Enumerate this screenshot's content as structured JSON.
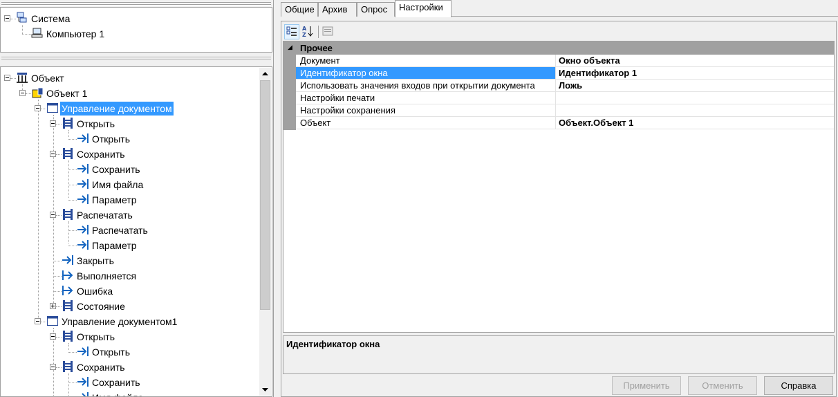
{
  "system_tree": {
    "root_label": "Система",
    "child_label": "Компьютер 1"
  },
  "object_tree": {
    "nodes": [
      {
        "label": "Объект"
      },
      {
        "label": "Объект 1"
      },
      {
        "label": "Управление документом"
      },
      {
        "label": "Открыть"
      },
      {
        "label": "Открыть"
      },
      {
        "label": "Сохранить"
      },
      {
        "label": "Сохранить"
      },
      {
        "label": "Имя файла"
      },
      {
        "label": "Параметр"
      },
      {
        "label": "Распечатать"
      },
      {
        "label": "Распечатать"
      },
      {
        "label": "Параметр"
      },
      {
        "label": "Закрыть"
      },
      {
        "label": "Выполняется"
      },
      {
        "label": "Ошибка"
      },
      {
        "label": "Состояние"
      },
      {
        "label": "Управление документом1"
      },
      {
        "label": "Открыть"
      },
      {
        "label": "Открыть"
      },
      {
        "label": "Сохранить"
      },
      {
        "label": "Сохранить"
      },
      {
        "label": "Имя файла"
      }
    ],
    "selected_index": 2
  },
  "tabs": [
    {
      "label": "Общие"
    },
    {
      "label": "Архив"
    },
    {
      "label": "Опрос"
    },
    {
      "label": "Настройки"
    }
  ],
  "active_tab": "Настройки",
  "properties": {
    "category": "Прочее",
    "rows": [
      {
        "name": "Документ",
        "value": "Окно объекта"
      },
      {
        "name": "Идентификатор окна",
        "value": "Идентификатор 1"
      },
      {
        "name": "Использовать значения входов при открытии документа",
        "value": "Ложь"
      },
      {
        "name": "Настройки печати",
        "value": ""
      },
      {
        "name": "Настройки сохранения",
        "value": ""
      },
      {
        "name": "Объект",
        "value": "Объект.Объект 1"
      }
    ],
    "selected_row": 1
  },
  "description": {
    "title": "Идентификатор окна"
  },
  "buttons": {
    "apply": "Применить",
    "cancel": "Отменить",
    "help": "Справка"
  },
  "colors": {
    "selection": "#3399ff",
    "category_band": "#a0a0a0"
  }
}
